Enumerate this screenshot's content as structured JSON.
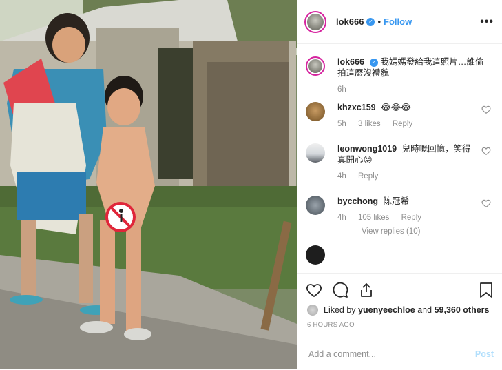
{
  "header": {
    "username": "lok666",
    "verified_glyph": "✓",
    "separator": "•",
    "follow_label": "Follow",
    "more_glyph": "•••"
  },
  "caption": {
    "username": "lok666",
    "text": "我媽媽發給我這照片…誰偷拍這麼沒禮貌",
    "time": "6h"
  },
  "comments": [
    {
      "username": "khzxc159",
      "text": "😂😂😂",
      "time": "5h",
      "likes": "3 likes",
      "reply": "Reply"
    },
    {
      "username": "leonwong1019",
      "text": "兒時嘅回憶，笑得真開心😝",
      "time": "4h",
      "reply": "Reply"
    },
    {
      "username": "bycchong",
      "text": "陈冠希",
      "time": "4h",
      "likes": "105 likes",
      "reply": "Reply",
      "view_replies": "View replies (10)"
    }
  ],
  "actions": {
    "like_icon": "heart-outline",
    "comment_icon": "speech-bubble",
    "share_icon": "share-arrow",
    "save_icon": "bookmark"
  },
  "likes": {
    "prefix": "Liked by",
    "user": "yuenyeechloe",
    "middle": "and",
    "count": "59,360 others"
  },
  "timestamp": "6 HOURS AGO",
  "add_comment": {
    "placeholder": "Add a comment...",
    "post_label": "Post"
  },
  "colors": {
    "accent": "#3897f0",
    "text": "#262626",
    "muted": "#8e8e8e",
    "post_disabled": "#b2dffc"
  }
}
